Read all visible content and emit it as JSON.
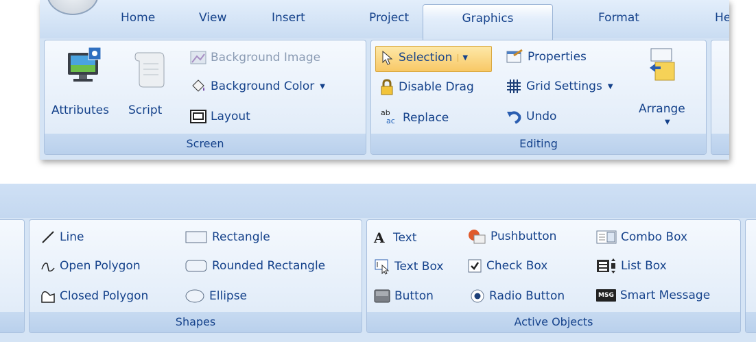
{
  "tabs": [
    "Home",
    "View",
    "Insert",
    "Project",
    "Graphics",
    "Format",
    "He"
  ],
  "active_tab": "Graphics",
  "screen_group": {
    "label": "Screen",
    "attributes": "Attributes",
    "script": "Script",
    "background_image": "Background Image",
    "background_color": "Background Color",
    "layout": "Layout"
  },
  "editing_group": {
    "label": "Editing",
    "selection": "Selection",
    "properties": "Properties",
    "disable_drag": "Disable Drag",
    "grid_settings": "Grid Settings",
    "replace": "Replace",
    "undo": "Undo",
    "arrange": "Arrange"
  },
  "shapes_group": {
    "label": "Shapes",
    "line": "Line",
    "rectangle": "Rectangle",
    "open_polygon": "Open Polygon",
    "rounded_rectangle": "Rounded Rectangle",
    "closed_polygon": "Closed Polygon",
    "ellipse": "Ellipse"
  },
  "active_objects_group": {
    "label": "Active Objects",
    "text": "Text",
    "pushbutton": "Pushbutton",
    "combo_box": "Combo Box",
    "text_box": "Text Box",
    "check_box": "Check Box",
    "list_box": "List Box",
    "button": "Button",
    "radio_button": "Radio Button",
    "smart_message": "Smart Message"
  },
  "icon_text": {
    "replace_ab": "ab",
    "replace_ac": "ac",
    "msg": "MSG"
  }
}
